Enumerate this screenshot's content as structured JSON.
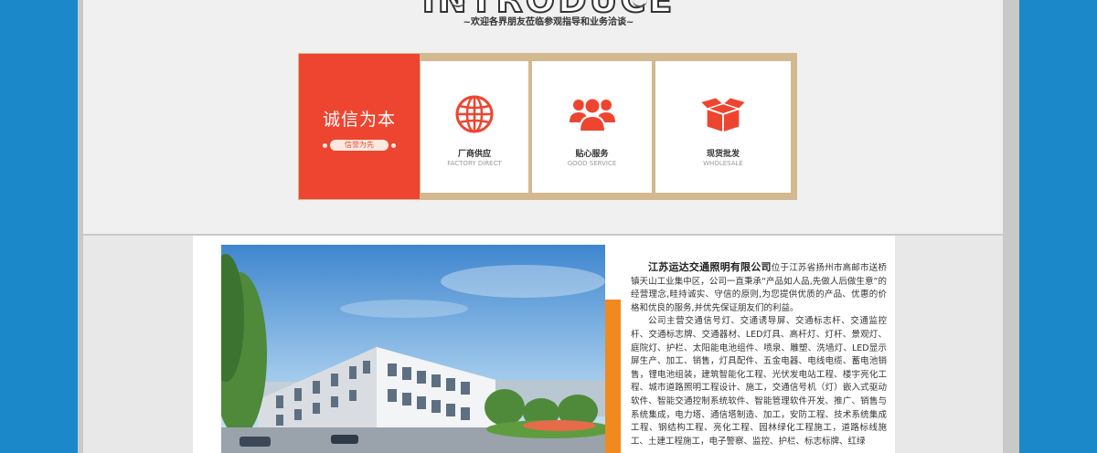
{
  "header": {
    "title": "INTRODUCE",
    "subtitle": "~欢迎各界朋友莅临参观指导和业务洽谈~"
  },
  "features": {
    "main": {
      "title": "诚信为本",
      "pill": "信誉为先"
    },
    "items": [
      {
        "title": "厂商供应",
        "subtitle": "FACTORY DIRECT",
        "icon": "globe-icon"
      },
      {
        "title": "贴心服务",
        "subtitle": "GOOD SERVICE",
        "icon": "people-icon"
      },
      {
        "title": "现货批发",
        "subtitle": "WHOLESALE",
        "icon": "box-icon"
      }
    ]
  },
  "company": {
    "name": "江苏运达交通照明有限公司",
    "intro": "位于江苏省扬州市高邮市送桥镇天山工业集中区，公司一直秉承“产品如人品,先做人后做生意”的经营理念,畦持诚实、守信的原则,为您提供优质的产品、优惠的价格和优良的服务,并优先保证朋友们的利益。",
    "business": "公司主营交通信号灯、交通诱导屏、交通标志杆、交通监控杆、交通标志牌、交通器材、LED灯具、高杆灯、灯杆、景观灯、庭院灯、护栏、太阳能电池组件、喷泉、雕塑、洗墙灯、LED显示屏生产、加工、销售，灯具配件、五金电器、电线电缆、蓄电池销售，锂电池组装，建筑智能化工程、光伏发电站工程、楼宇亮化工程、城市道路照明工程设计、施工，交通信号机（灯）嵌入式驱动软件、智能交通控制系统软件、智能管理软件开发、推广、销售与系统集成，电力塔、通信塔制造、加工，安防工程、技术系统集成工程、钢结构工程、亮化工程、园林绿化工程施工，道路标线施工、土建工程施工，电子警察、监控、护栏、标志标牌、红绿"
  },
  "colors": {
    "page_bg": "#1a88c9",
    "accent_red": "#ee4530",
    "accent_orange": "#f08a1e",
    "frame_tan": "#d3b990"
  }
}
